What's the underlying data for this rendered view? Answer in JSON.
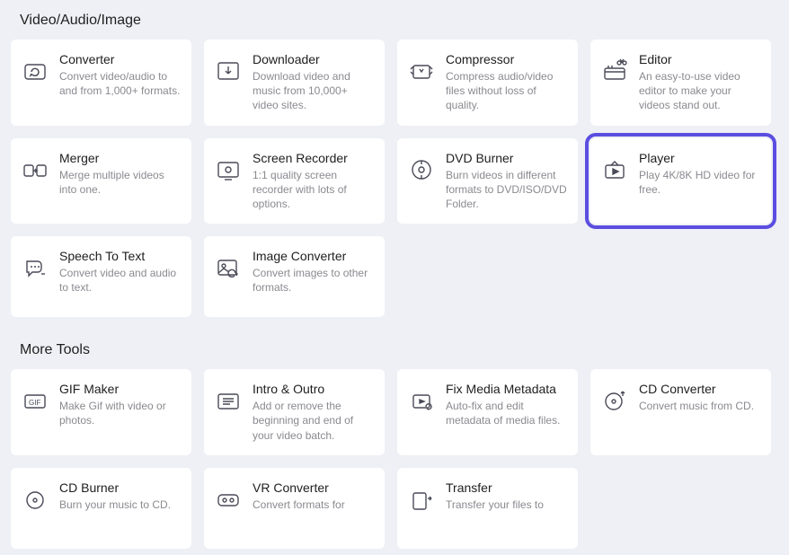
{
  "sections": [
    {
      "title": "Video/Audio/Image",
      "items": [
        {
          "id": "converter",
          "title": "Converter",
          "desc": "Convert video/audio to and from 1,000+ formats.",
          "icon": "refresh-camera",
          "highlight": false
        },
        {
          "id": "downloader",
          "title": "Downloader",
          "desc": "Download video and music from 10,000+ video sites.",
          "icon": "download-tray",
          "highlight": false
        },
        {
          "id": "compressor",
          "title": "Compressor",
          "desc": "Compress audio/video files without loss of quality.",
          "icon": "compress",
          "highlight": false
        },
        {
          "id": "editor",
          "title": "Editor",
          "desc": "An easy-to-use video editor to make your videos stand out.",
          "icon": "scissors-film",
          "highlight": false
        },
        {
          "id": "merger",
          "title": "Merger",
          "desc": "Merge multiple videos into one.",
          "icon": "merge",
          "highlight": false
        },
        {
          "id": "screenrec",
          "title": "Screen Recorder",
          "desc": "1:1 quality screen recorder with lots of options.",
          "icon": "screen-record",
          "highlight": false
        },
        {
          "id": "dvdburner",
          "title": "DVD Burner",
          "desc": "Burn videos in different formats to DVD/ISO/DVD Folder.",
          "icon": "disc",
          "highlight": false
        },
        {
          "id": "player",
          "title": "Player",
          "desc": "Play 4K/8K HD video for free.",
          "icon": "tv-play",
          "highlight": true
        },
        {
          "id": "stt",
          "title": "Speech To Text",
          "desc": "Convert video and audio to text.",
          "icon": "speech",
          "highlight": false
        },
        {
          "id": "imgconv",
          "title": "Image Converter",
          "desc": "Convert images to other formats.",
          "icon": "image-refresh",
          "highlight": false
        }
      ]
    },
    {
      "title": "More Tools",
      "items": [
        {
          "id": "gifmaker",
          "title": "GIF Maker",
          "desc": "Make Gif with video or photos.",
          "icon": "gif",
          "highlight": false
        },
        {
          "id": "introoutro",
          "title": "Intro & Outro",
          "desc": "Add or remove the beginning and end of your video batch.",
          "icon": "intro",
          "highlight": false
        },
        {
          "id": "fixmeta",
          "title": "Fix Media Metadata",
          "desc": "Auto-fix and edit metadata of media files.",
          "icon": "metadata",
          "highlight": false
        },
        {
          "id": "cdconv",
          "title": "CD Converter",
          "desc": "Convert music from CD.",
          "icon": "cd-up",
          "highlight": false
        },
        {
          "id": "cdburner",
          "title": "CD Burner",
          "desc": "Burn your music to CD.",
          "icon": "cd-burn",
          "highlight": false
        },
        {
          "id": "vrconv",
          "title": "VR Converter",
          "desc": "Convert formats for",
          "icon": "vr",
          "highlight": false
        },
        {
          "id": "transfer",
          "title": "Transfer",
          "desc": "Transfer your files to",
          "icon": "transfer",
          "highlight": false
        }
      ]
    }
  ]
}
